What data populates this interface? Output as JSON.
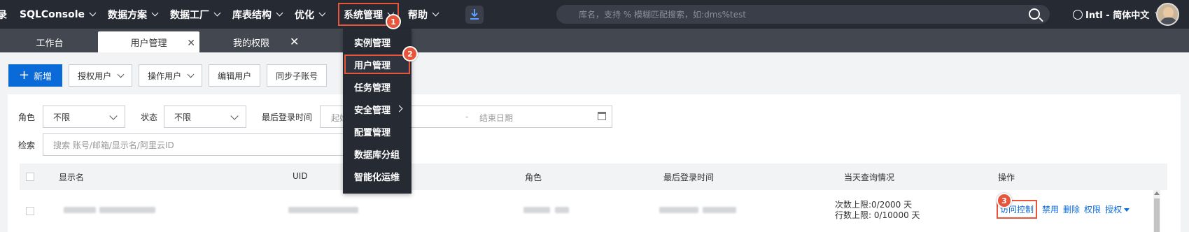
{
  "topnav": {
    "items": [
      {
        "label": "SQLConsole"
      },
      {
        "label": "数据方案"
      },
      {
        "label": "数据工厂"
      },
      {
        "label": "库表结构"
      },
      {
        "label": "优化"
      },
      {
        "label": "系统管理"
      },
      {
        "label": "帮助"
      }
    ],
    "first_partial": "录",
    "search_placeholder": "库名，支持 % 模糊匹配搜索，如:dms%test",
    "lang_label": "Intl - 简体中文"
  },
  "tabs": [
    {
      "label": "工作台"
    },
    {
      "label": "用户管理"
    },
    {
      "label": "我的权限"
    }
  ],
  "toolbar": {
    "add": "新增",
    "grant_user": "授权用户",
    "operate_user": "操作用户",
    "edit_user": "编辑用户",
    "sync_sub": "同步子账号"
  },
  "filters": {
    "role_label": "角色",
    "role_value": "不限",
    "status_label": "状态",
    "status_value": "不限",
    "last_login_label": "最后登录时间",
    "start_date": "起始日期",
    "date_sep": "-",
    "end_date": "结束日期",
    "search_label": "检索",
    "search_placeholder": "搜索 账号/邮箱/显示名/阿里云ID"
  },
  "table": {
    "headers": [
      "显示名",
      "UID",
      "角色",
      "最后登录时间",
      "当天查询情况",
      "操作"
    ],
    "row": {
      "query_line1": "次数上限:0/2000 天",
      "query_line2": "行数上限: 0/10000 天",
      "ops": [
        "访问控制",
        "禁用",
        "删除",
        "权限",
        "授权"
      ]
    }
  },
  "menu": {
    "items": [
      "实例管理",
      "用户管理",
      "任务管理",
      "安全管理",
      "配置管理",
      "数据库分组",
      "智能化运维"
    ]
  },
  "badges": [
    "1",
    "2",
    "3"
  ],
  "colors": {
    "topbar": "#262a33",
    "tabbar": "#43474f",
    "accent": "#0a6ad8",
    "highlight": "#e8553a"
  }
}
